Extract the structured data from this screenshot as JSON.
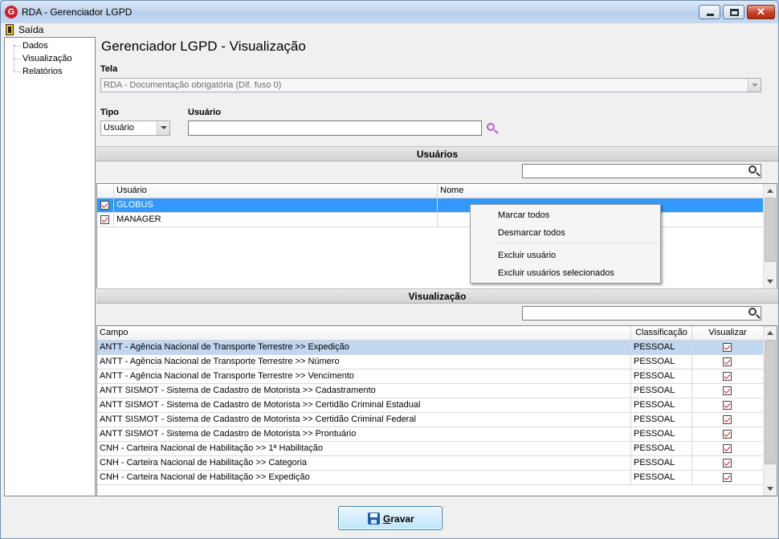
{
  "window": {
    "title": "RDA - Gerenciador LGPD",
    "app_icon_letter": "G",
    "close_glyph": "✕"
  },
  "menu": {
    "exit_label": "Saída",
    "exit_icon": "exit-door-icon"
  },
  "nav": {
    "items": [
      "Dados",
      "Visualização",
      "Relatórios"
    ]
  },
  "page": {
    "title": "Gerenciador LGPD - Visualização"
  },
  "form": {
    "tela_label": "Tela",
    "tela_value": "RDA - Documentação obrigatória (Dif. fuso 0)",
    "tipo_label": "Tipo",
    "tipo_value": "Usuário",
    "usuario_label": "Usuário",
    "usuario_value": ""
  },
  "users_section": {
    "header": "Usuários",
    "search_value": "",
    "columns": [
      "Usuário",
      "Nome"
    ],
    "rows": [
      {
        "checked": true,
        "usuario": "GLOBUS",
        "nome": ""
      },
      {
        "checked": true,
        "usuario": "MANAGER",
        "nome": ""
      }
    ]
  },
  "context_menu": {
    "items": [
      "Marcar todos",
      "Desmarcar todos",
      "Excluir usuário",
      "Excluir usuários selecionados"
    ]
  },
  "view_section": {
    "header": "Visualização",
    "search_value": "",
    "columns": [
      "Campo",
      "Classificação",
      "Visualizar"
    ],
    "rows": [
      {
        "campo": "ANTT - Agência Nacional de Transporte Terrestre >> Expedição",
        "classificacao": "PESSOAL",
        "visualizar": true
      },
      {
        "campo": "ANTT - Agência Nacional de Transporte Terrestre >> Número",
        "classificacao": "PESSOAL",
        "visualizar": true
      },
      {
        "campo": "ANTT - Agência Nacional de Transporte Terrestre >> Vencimento",
        "classificacao": "PESSOAL",
        "visualizar": true
      },
      {
        "campo": "ANTT SISMOT - Sistema de Cadastro de Motorista >> Cadastramento",
        "classificacao": "PESSOAL",
        "visualizar": true
      },
      {
        "campo": "ANTT SISMOT - Sistema de Cadastro de Motorista >> Certidão Criminal Estadual",
        "classificacao": "PESSOAL",
        "visualizar": true
      },
      {
        "campo": "ANTT SISMOT - Sistema de Cadastro de Motorista >> Certidão Criminal Federal",
        "classificacao": "PESSOAL",
        "visualizar": true
      },
      {
        "campo": "ANTT SISMOT - Sistema de Cadastro de Motorista >> Prontuário",
        "classificacao": "PESSOAL",
        "visualizar": true
      },
      {
        "campo": "CNH - Carteira Nacional de Habilitação >> 1ª Habilitação",
        "classificacao": "PESSOAL",
        "visualizar": true
      },
      {
        "campo": "CNH - Carteira Nacional de Habilitação >> Categoria",
        "classificacao": "PESSOAL",
        "visualizar": true
      },
      {
        "campo": "CNH - Carteira Nacional de Habilitação >> Expedição",
        "classificacao": "PESSOAL",
        "visualizar": true
      }
    ]
  },
  "footer": {
    "save_first": "G",
    "save_rest": "ravar",
    "save_icon": "floppy-disk-icon"
  },
  "colors": {
    "selection": "#3399ff",
    "row_highlight": "#c1d6ef",
    "check": "#e02020",
    "search_icon": "#b25fdc"
  }
}
